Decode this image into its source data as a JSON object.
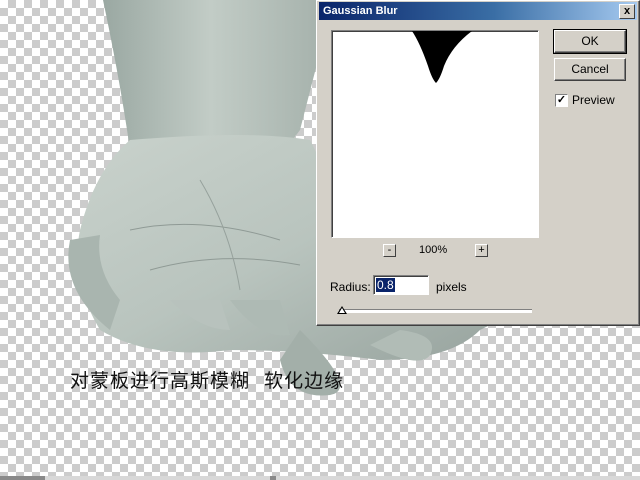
{
  "dialog": {
    "title": "Gaussian Blur",
    "close_label": "x",
    "ok_label": "OK",
    "cancel_label": "Cancel",
    "preview_label": "Preview",
    "preview_checked": true,
    "zoom_out_label": "-",
    "zoom_level": "100%",
    "zoom_in_label": "+",
    "radius_label": "Radius:",
    "radius_value": "0.8",
    "radius_units": "pixels"
  },
  "canvas": {
    "caption": "对蒙板进行高斯模糊  软化边缘"
  },
  "colors": {
    "titlebar_start": "#0a246a",
    "titlebar_end": "#a6caf0",
    "dialog_face": "#d4d0c8"
  }
}
